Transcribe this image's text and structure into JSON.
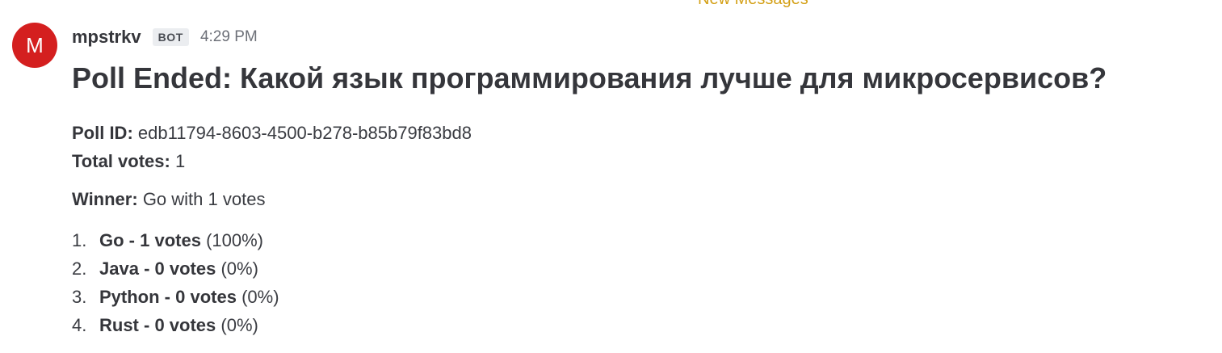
{
  "banner": {
    "text": "New Messages"
  },
  "message": {
    "avatar_letter": "M",
    "username": "mpstrkv",
    "badge": "BOT",
    "timestamp": "4:29 PM",
    "title": "Poll Ended: Какой язык программирования лучше для микросервисов?",
    "poll_id_label": "Poll ID:",
    "poll_id_value": "edb11794-8603-4500-b278-b85b79f83bd8",
    "total_votes_label": "Total votes:",
    "total_votes_value": "1",
    "winner_label": "Winner:",
    "winner_value": "Go with 1 votes",
    "results": [
      {
        "number": "1.",
        "option": "Go",
        "separator": " - ",
        "votes": "1 votes",
        "percent": "(100%)"
      },
      {
        "number": "2.",
        "option": "Java",
        "separator": " - ",
        "votes": "0 votes",
        "percent": "(0%)"
      },
      {
        "number": "3.",
        "option": "Python",
        "separator": " - ",
        "votes": "0 votes",
        "percent": "(0%)"
      },
      {
        "number": "4.",
        "option": "Rust",
        "separator": " - ",
        "votes": "0 votes",
        "percent": "(0%)"
      }
    ]
  },
  "colors": {
    "avatar": "#d41f1f",
    "banner": "#d4a017",
    "text": "#35363b"
  }
}
